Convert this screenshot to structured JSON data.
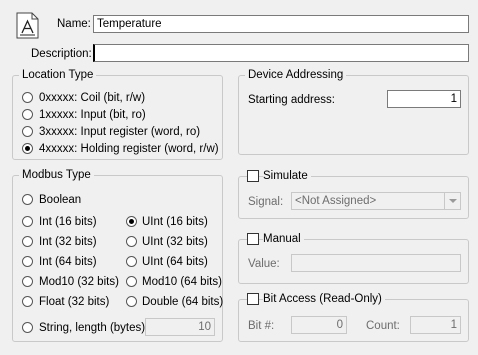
{
  "header": {
    "icon": "tag-document-icon",
    "name_label": "Name:",
    "name_value": "Temperature",
    "description_label": "Description:",
    "description_value": ""
  },
  "location_type": {
    "title": "Location Type",
    "options": [
      "0xxxxx: Coil (bit, r/w)",
      "1xxxxx: Input (bit, ro)",
      "3xxxxx: Input register (word, ro)",
      "4xxxxx: Holding register (word, r/w)"
    ],
    "selected": "4xxxxx: Holding register (word, r/w)"
  },
  "device_addressing": {
    "title": "Device Addressing",
    "starting_address_label": "Starting address:",
    "starting_address_value": "1"
  },
  "modbus_type": {
    "title": "Modbus Type",
    "boolean": "Boolean",
    "int16": "Int (16 bits)",
    "uint16": "UInt (16 bits)",
    "int32": "Int (32 bits)",
    "uint32": "UInt (32 bits)",
    "int64": "Int (64 bits)",
    "uint64": "UInt (64 bits)",
    "mod10_32": "Mod10 (32 bits)",
    "mod10_64": "Mod10 (64 bits)",
    "float32": "Float (32 bits)",
    "double64": "Double (64 bits)",
    "string_label": "String, length (bytes):",
    "string_length": "10",
    "selected": "UInt (16 bits)"
  },
  "simulate": {
    "title": "Simulate",
    "checked": false,
    "signal_label": "Signal:",
    "signal_value": "<Not Assigned>"
  },
  "manual": {
    "title": "Manual",
    "checked": false,
    "value_label": "Value:",
    "value": ""
  },
  "bit_access": {
    "title": "Bit Access (Read-Only)",
    "checked": false,
    "bit_label": "Bit #:",
    "bit_value": "0",
    "count_label": "Count:",
    "count_value": "1"
  }
}
